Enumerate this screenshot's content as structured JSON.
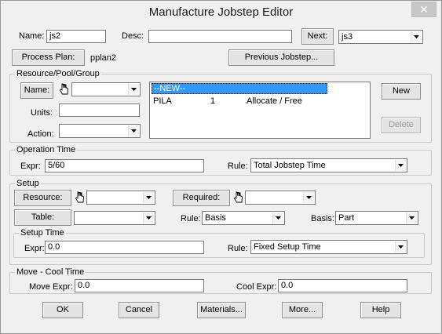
{
  "window": {
    "title": "Manufacture Jobstep Editor",
    "close_glyph": "✕"
  },
  "header": {
    "name_label": "Name:",
    "name_value": "js2",
    "desc_label": "Desc:",
    "desc_value": "",
    "next_label": "Next:",
    "next_value": "js3",
    "process_plan_label": "Process Plan:",
    "process_plan_value": "pplan2",
    "previous_jobstep_label": "Previous Jobstep..."
  },
  "resource": {
    "group_title": "Resource/Pool/Group",
    "name_label": "Name:",
    "name_value": "",
    "units_label": "Units:",
    "units_value": "",
    "action_label": "Action:",
    "action_value": "",
    "new_label": "New",
    "delete_label": "Delete",
    "list": [
      {
        "name": "--NEW--",
        "units": "",
        "action": "",
        "selected": true
      },
      {
        "name": "PILA",
        "units": "1",
        "action": "Allocate / Free",
        "selected": false
      }
    ]
  },
  "operation_time": {
    "group_title": "Operation Time",
    "expr_label": "Expr:",
    "expr_value": "5/60",
    "rule_label": "Rule:",
    "rule_value": "Total Jobstep Time"
  },
  "setup": {
    "group_title": "Setup",
    "resource_label": "Resource:",
    "resource_value": "",
    "required_label": "Required:",
    "required_value": "",
    "table_label": "Table:",
    "table_value": "",
    "rule_label": "Rule:",
    "rule_value": "Basis",
    "basis_label": "Basis:",
    "basis_value": "Part",
    "setup_time": {
      "group_title": "Setup Time",
      "expr_label": "Expr:",
      "expr_value": "0.0",
      "rule_label": "Rule:",
      "rule_value": "Fixed Setup Time"
    }
  },
  "move_cool": {
    "group_title": "Move - Cool Time",
    "move_label": "Move Expr:",
    "move_value": "0.0",
    "cool_label": "Cool Expr:",
    "cool_value": "0.0"
  },
  "footer": {
    "ok": "OK",
    "cancel": "Cancel",
    "materials": "Materials...",
    "more": "More...",
    "help": "Help"
  },
  "icons": {
    "hand": "hand-pointer-icon",
    "dropdown": "chevron-down-icon"
  },
  "colors": {
    "selection": "#3399ff",
    "background": "#f0f0f0"
  }
}
